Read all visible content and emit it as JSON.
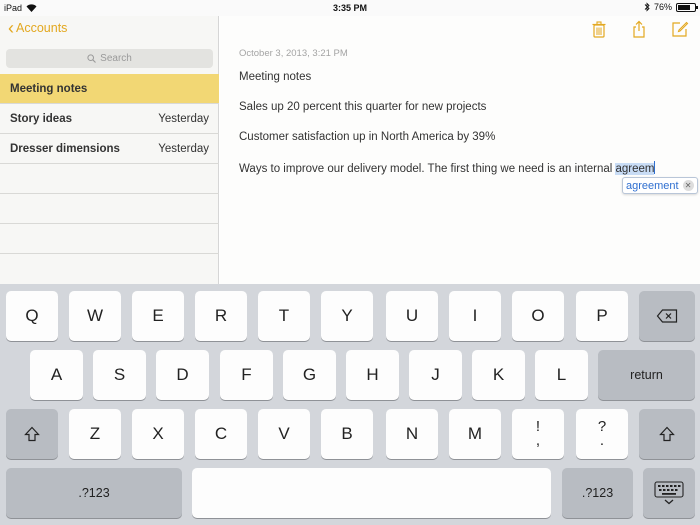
{
  "status_bar": {
    "device": "iPad",
    "time": "3:35 PM",
    "battery": "76%",
    "battery_level": 0.76
  },
  "sidebar": {
    "back_label": "Accounts",
    "search_placeholder": "Search",
    "notes": [
      {
        "title": "Meeting notes",
        "date": "",
        "selected": true
      },
      {
        "title": "Story ideas",
        "date": "Yesterday",
        "selected": false
      },
      {
        "title": "Dresser dimensions",
        "date": "Yesterday",
        "selected": false
      }
    ]
  },
  "note": {
    "timestamp": "October 3, 2013, 3:21 PM",
    "line1": "Meeting notes",
    "line2": "Sales up 20 percent this quarter for new projects",
    "line3": "Customer satisfaction up in North America by 39%",
    "line4_prefix": "Ways to improve our delivery model.  The first thing we need is an internal ",
    "line4_highlight": "agreem",
    "suggestion": "agreement"
  },
  "keyboard": {
    "row1": [
      "Q",
      "W",
      "E",
      "R",
      "T",
      "Y",
      "U",
      "I",
      "O",
      "P"
    ],
    "row2": [
      "A",
      "S",
      "D",
      "F",
      "G",
      "H",
      "J",
      "K",
      "L"
    ],
    "row3": [
      "Z",
      "X",
      "C",
      "V",
      "B",
      "N",
      "M"
    ],
    "return_label": "return",
    "numbers_label": ".?123",
    "exclaim_top": "!",
    "exclaim_bottom": ",",
    "question_top": "?",
    "question_bottom": "."
  },
  "colors": {
    "accent": "#e3a820",
    "selected_row": "#f2d774",
    "keyboard_bg": "#d3d6db"
  }
}
